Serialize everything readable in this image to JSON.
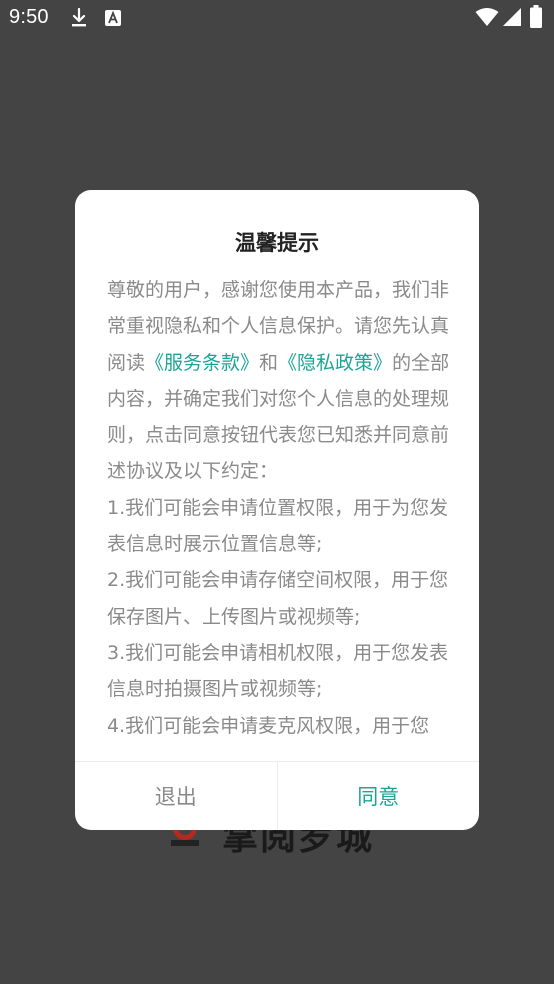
{
  "status_bar": {
    "time": "9:50",
    "icons": [
      "download-icon",
      "app-notification-icon",
      "wifi-icon",
      "signal-icon",
      "battery-icon"
    ]
  },
  "background": {
    "logo_text": "掌阅罗城",
    "emblem_text": "掌阅罗城"
  },
  "dialog": {
    "title": "温馨提示",
    "intro_before": "尊敬的用户，感谢您使用本产品，我们非常重视隐私和个人信息保护。请您先认真阅读",
    "terms_link": "《服务条款》",
    "and_text": "和",
    "privacy_link": "《隐私政策》",
    "intro_after": "的全部内容，并确定我们对您个人信息的处理规则，点击同意按钮代表您已知悉并同意前述协议及以下约定：",
    "items": [
      "1.我们可能会申请位置权限，用于为您发表信息时展示位置信息等;",
      "2.我们可能会申请存储空间权限，用于您保存图片、上传图片或视频等;",
      "3.我们可能会申请相机权限，用于您发表信息时拍摄图片或视频等;",
      "4.我们可能会申请麦克风权限，用于您"
    ],
    "exit_label": "退出",
    "agree_label": "同意"
  },
  "colors": {
    "accent": "#1aa596",
    "overlay": "#444444",
    "body_text": "#8a8a8a"
  }
}
